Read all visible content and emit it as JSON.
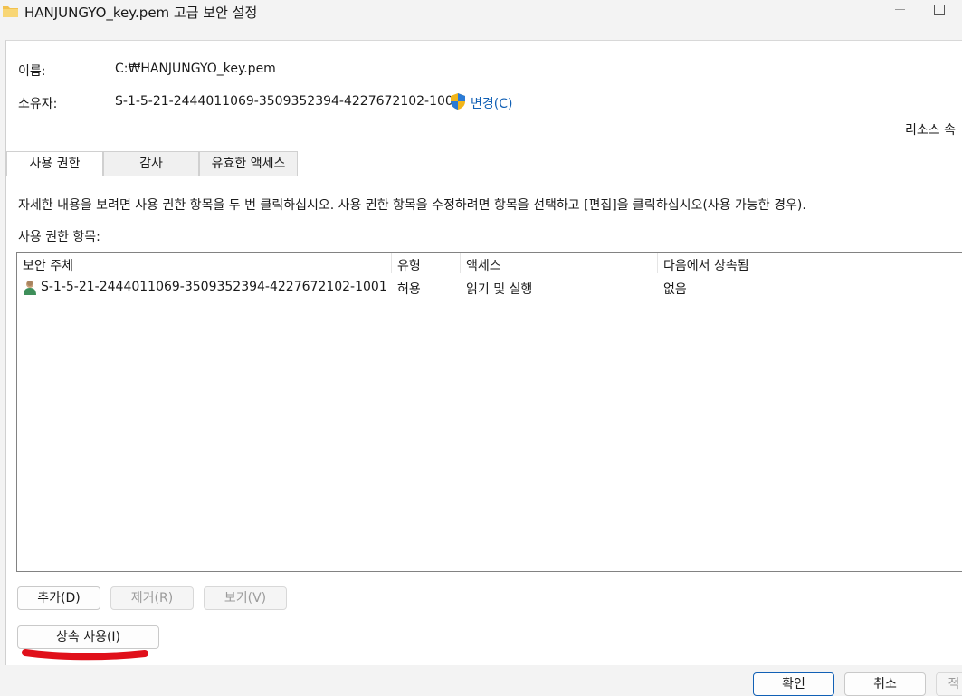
{
  "window": {
    "title": "HANJUNGYO_key.pem 고급 보안 설정"
  },
  "info": {
    "name_label": "이름:",
    "name_value": "C:₩HANJUNGYO_key.pem",
    "owner_label": "소유자:",
    "owner_value": "S-1-5-21-2444011069-3509352394-4227672102-1001",
    "change_link": "변경(C)",
    "resource_text": "리소스 속"
  },
  "tabs": [
    {
      "label": "사용 권한",
      "active": true
    },
    {
      "label": "감사",
      "active": false
    },
    {
      "label": "유효한 액세스",
      "active": false
    }
  ],
  "permissions": {
    "instructions": "자세한 내용을 보려면 사용 권한 항목을 두 번 클릭하십시오. 사용 권한 항목을 수정하려면 항목을 선택하고 [편집]을 클릭하십시오(사용 가능한 경우).",
    "list_label": "사용 권한 항목:",
    "columns": [
      "보안 주체",
      "유형",
      "액세스",
      "다음에서 상속됨"
    ],
    "rows": [
      {
        "principal": "S-1-5-21-2444011069-3509352394-4227672102-1001",
        "type": "허용",
        "access": "읽기 및 실행",
        "inherited_from": "없음"
      }
    ]
  },
  "buttons": {
    "add": "추가(D)",
    "remove": "제거(R)",
    "view": "보기(V)",
    "enable_inheritance": "상속 사용(I)",
    "ok": "확인",
    "cancel": "취소",
    "apply": "적"
  },
  "colors": {
    "link": "#1160b5",
    "annotation": "#e0101a"
  }
}
